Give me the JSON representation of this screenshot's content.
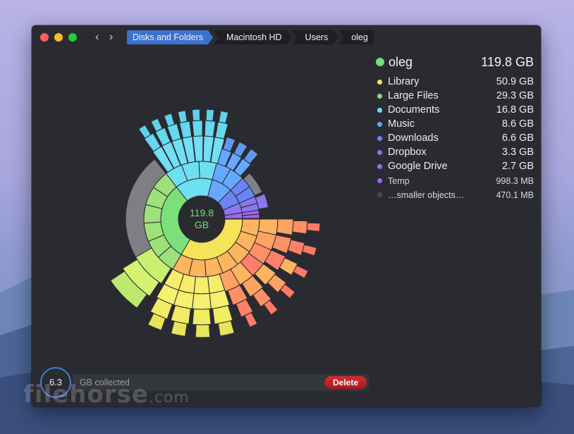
{
  "window": {
    "breadcrumbs": [
      "Disks and Folders",
      "Macintosh HD",
      "Users",
      "oleg"
    ],
    "nav_back": "‹",
    "nav_forward": "›"
  },
  "chart_center": {
    "value": "119.8",
    "unit": "GB"
  },
  "summary": {
    "name": "oleg",
    "size": "119.8 GB",
    "color": "#6fe07a"
  },
  "items": [
    {
      "name": "Library",
      "size": "50.9 GB",
      "color": "#f5e35a"
    },
    {
      "name": "Large Files",
      "size": "29.3 GB",
      "color": "#7be07a"
    },
    {
      "name": "Documents",
      "size": "16.8 GB",
      "color": "#6fdff2"
    },
    {
      "name": "Music",
      "size": "8.6 GB",
      "color": "#66a8ff"
    },
    {
      "name": "Downloads",
      "size": "6.6 GB",
      "color": "#6b85f4"
    },
    {
      "name": "Dropbox",
      "size": "3.3 GB",
      "color": "#8b76ef"
    },
    {
      "name": "Google Drive",
      "size": "2.7 GB",
      "color": "#9a6cf0"
    },
    {
      "name": "Temp",
      "size": "998.3  MB",
      "color": "#a064f2",
      "small": true
    },
    {
      "name": "…smaller objects…",
      "size": "470.1  MB",
      "color": "#4a4b52",
      "small": true
    }
  ],
  "collector": {
    "value": "6.3",
    "label": "GB collected",
    "delete_label": "Delete"
  },
  "watermark": {
    "text": "filehorse",
    "suffix": ".com"
  }
}
